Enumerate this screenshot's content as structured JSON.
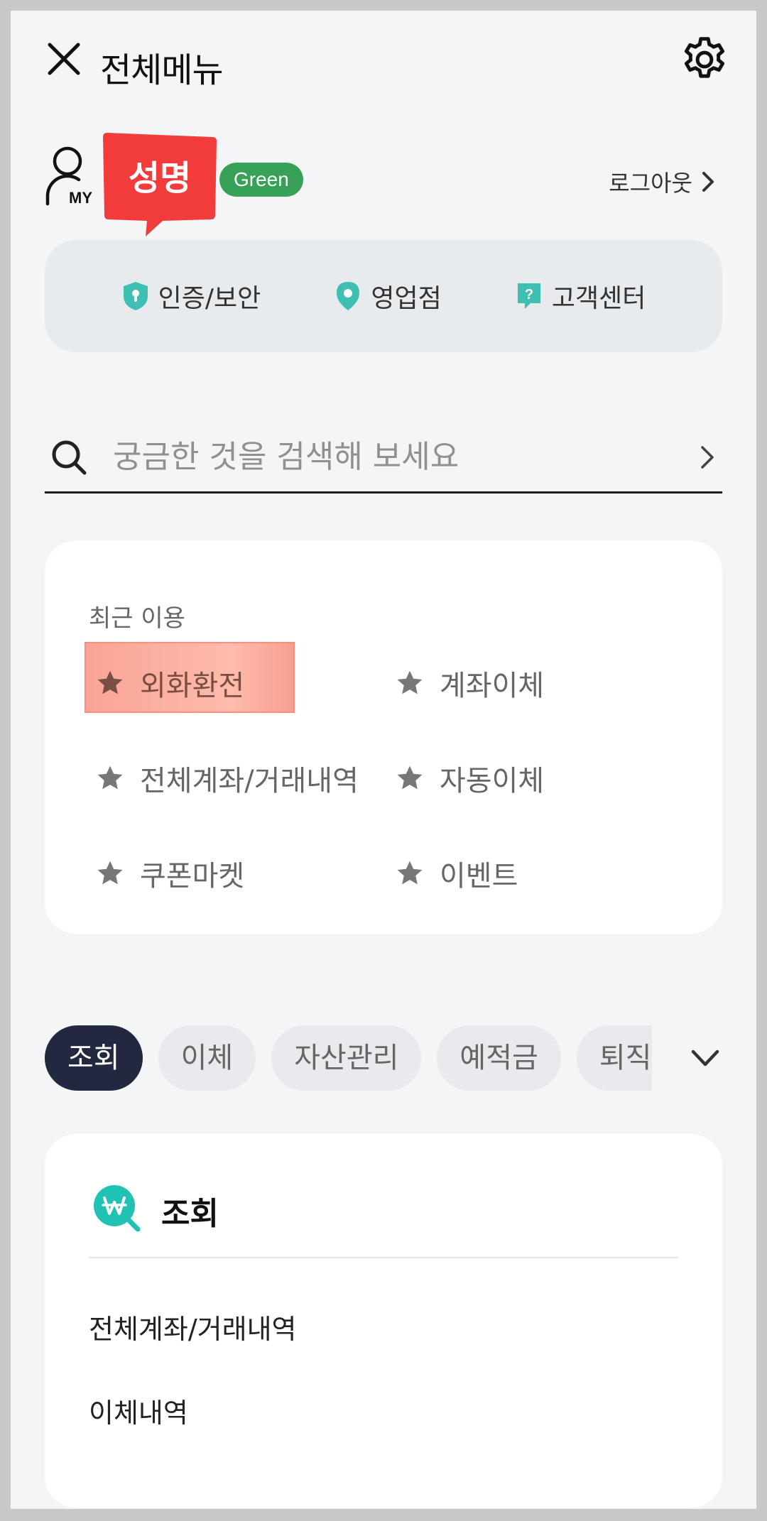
{
  "header": {
    "title": "전체메뉴"
  },
  "profile": {
    "user_icon_label": "MY",
    "name": "성명",
    "grade": "Green",
    "logout_label": "로그아웃"
  },
  "quick_menu": {
    "items": [
      {
        "label": "인증/보안",
        "icon": "shield-icon"
      },
      {
        "label": "영업점",
        "icon": "location-pin-icon"
      },
      {
        "label": "고객센터",
        "icon": "help-chat-icon"
      }
    ]
  },
  "search": {
    "placeholder": "궁금한 것을 검색해 보세요"
  },
  "recent": {
    "title": "최근 이용",
    "items": [
      {
        "label": "외화환전"
      },
      {
        "label": "계좌이체"
      },
      {
        "label": "전체계좌/거래내역"
      },
      {
        "label": "자동이체"
      },
      {
        "label": "쿠폰마켓"
      },
      {
        "label": "이벤트"
      }
    ]
  },
  "tabs": [
    {
      "label": "조회",
      "active": true
    },
    {
      "label": "이체"
    },
    {
      "label": "자산관리"
    },
    {
      "label": "예적금"
    },
    {
      "label": "퇴직연금"
    }
  ],
  "section": {
    "title": "조회",
    "icon": "won-search-icon",
    "links": [
      {
        "label": "전체계좌/거래내역"
      },
      {
        "label": "이체내역"
      }
    ]
  },
  "colors": {
    "grade_badge": "#36a157",
    "name_bubble": "#f23b3b",
    "active_tab": "#222840",
    "accent_teal": "#1fc2b3",
    "highlight": "#f8a090"
  }
}
